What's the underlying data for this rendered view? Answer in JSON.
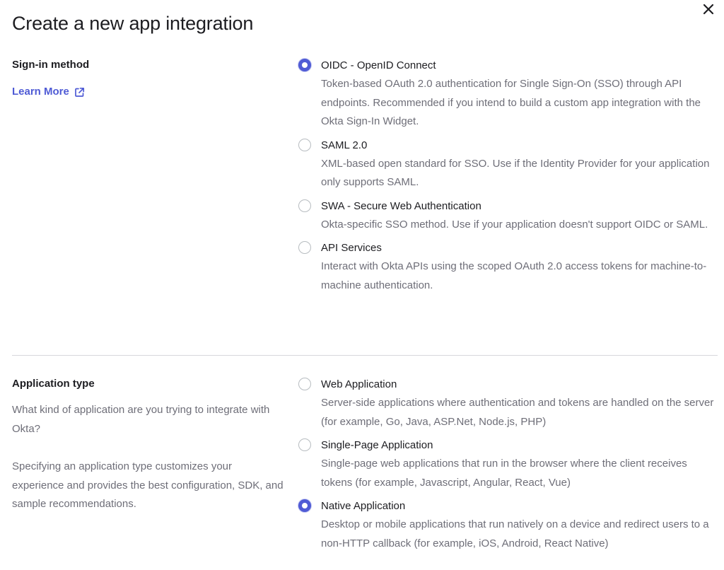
{
  "title": "Create a new app integration",
  "sign_in": {
    "heading": "Sign-in method",
    "learn_more": "Learn More",
    "options": [
      {
        "label": "OIDC - OpenID Connect",
        "desc": "Token-based OAuth 2.0 authentication for Single Sign-On (SSO) through API endpoints. Recommended if you intend to build a custom app integration with the Okta Sign-In Widget.",
        "selected": true
      },
      {
        "label": "SAML 2.0",
        "desc": "XML-based open standard for SSO. Use if the Identity Provider for your application only supports SAML.",
        "selected": false
      },
      {
        "label": "SWA - Secure Web Authentication",
        "desc": "Okta-specific SSO method. Use if your application doesn't support OIDC or SAML.",
        "selected": false
      },
      {
        "label": "API Services",
        "desc": "Interact with Okta APIs using the scoped OAuth 2.0 access tokens for machine-to-machine authentication.",
        "selected": false
      }
    ]
  },
  "app_type": {
    "heading": "Application type",
    "help_1": "What kind of application are you trying to integrate with Okta?",
    "help_2": "Specifying an application type customizes your experience and provides the best configuration, SDK, and sample recommendations.",
    "options": [
      {
        "label": "Web Application",
        "desc": "Server-side applications where authentication and tokens are handled on the server (for example, Go, Java, ASP.Net, Node.js, PHP)",
        "selected": false
      },
      {
        "label": "Single-Page Application",
        "desc": "Single-page web applications that run in the browser where the client receives tokens (for example, Javascript, Angular, React, Vue)",
        "selected": false
      },
      {
        "label": "Native Application",
        "desc": "Desktop or mobile applications that run natively on a device and redirect users to a non-HTTP callback (for example, iOS, Android, React Native)",
        "selected": true
      }
    ]
  },
  "colors": {
    "accent": "#4f5bd5",
    "text": "#1d1d21",
    "muted": "#6e6e78",
    "divider": "#d7d7dc"
  },
  "icons": {
    "close": "close-icon",
    "external_link": "external-link-icon"
  }
}
